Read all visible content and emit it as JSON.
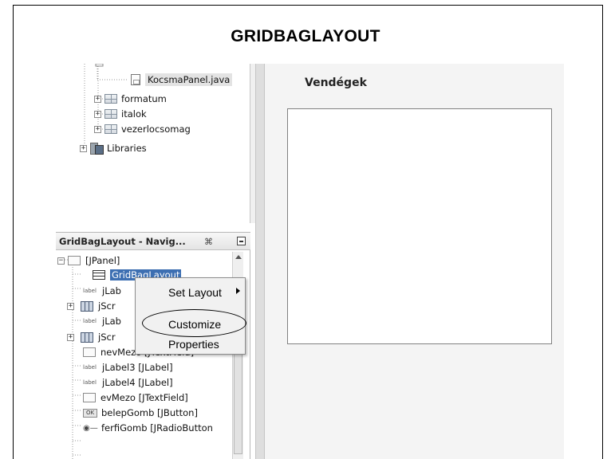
{
  "slide": {
    "title": "GRIDBAGLAYOUT"
  },
  "project_tree": {
    "items": [
      {
        "label": "KocsmaPanel.java",
        "icon": "java-file-icon",
        "selected": true
      },
      {
        "label": "formatum",
        "icon": "package-icon"
      },
      {
        "label": "italok",
        "icon": "package-icon"
      },
      {
        "label": "vezerlocsomag",
        "icon": "package-icon"
      },
      {
        "label": "Libraries",
        "icon": "libraries-icon"
      }
    ]
  },
  "navigator": {
    "title": "GridBagLayout - Navig...",
    "close_glyph": "⌘",
    "expander_minus": "−",
    "expander_plus": "+",
    "items": [
      {
        "label": "[JPanel]",
        "icon": "panel-icon"
      },
      {
        "label": "GridBagLayout",
        "icon": "gridbag-icon",
        "selected": true
      },
      {
        "label": "jLab",
        "icon_text": "label"
      },
      {
        "label": "jScr",
        "icon": "scrollpane-icon"
      },
      {
        "label": "jLab",
        "icon_text": "label"
      },
      {
        "label": "jScr",
        "icon": "scrollpane-icon"
      },
      {
        "label": "nevMezo [JTextField]",
        "icon": "textfield-icon"
      },
      {
        "label": "jLabel3 [JLabel]",
        "icon_text": "label"
      },
      {
        "label": "jLabel4 [JLabel]",
        "icon_text": "label"
      },
      {
        "label": "evMezo [JTextField]",
        "icon": "textfield-icon"
      },
      {
        "label": "belepGomb [JButton]",
        "icon_text": "OK"
      },
      {
        "label": "ferfiGomb [JRadioButton",
        "icon": "radio-icon",
        "icon_glyph": "◉—"
      }
    ]
  },
  "context_menu": {
    "items": [
      {
        "label": "Set Layout",
        "has_submenu": true
      },
      {
        "label": "Customize",
        "highlighted": true
      },
      {
        "label": "Properties"
      }
    ]
  },
  "design": {
    "label": "Vendégek"
  },
  "colors": {
    "selection": "#3d6fb2",
    "design_bg": "#f4f4f4",
    "border": "#808080"
  }
}
